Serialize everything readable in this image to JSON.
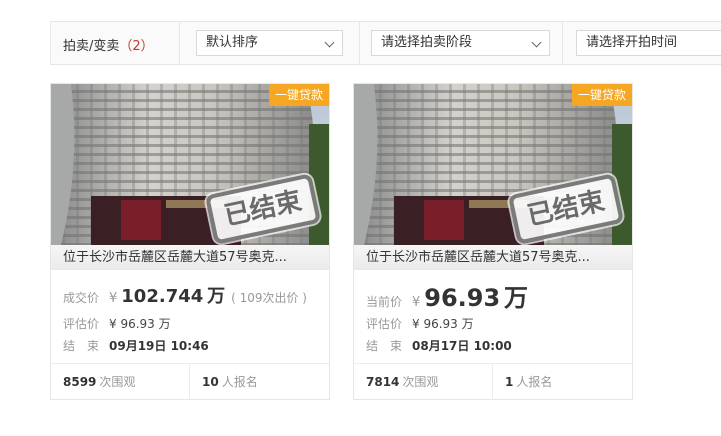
{
  "filters": {
    "category_label": "拍卖/变卖",
    "category_count": "（2）",
    "sort_value": "默认排序",
    "stage_value": "请选择拍卖阶段",
    "time_placeholder": "请选择开拍时间"
  },
  "accent_color": "#f5a623",
  "cards": [
    {
      "badge": "一键贷款",
      "stamp": "已结束",
      "title": "位于长沙市岳麓区岳麓大道57号奥克...",
      "price_label": "成交价",
      "currency": "¥",
      "price": "102.744",
      "price_unit": "万",
      "bids": "( 109次出价 )",
      "eval_label": "评估价",
      "eval_value": "¥ 96.93 万",
      "end_label": "结　束",
      "end_value": "09月19日 10:46",
      "views": "8599",
      "views_suffix": "次围观",
      "signups": "10",
      "signups_suffix": "人报名"
    },
    {
      "badge": "一键贷款",
      "stamp": "已结束",
      "title": "位于长沙市岳麓区岳麓大道57号奥克...",
      "price_label": "当前价",
      "currency": "¥",
      "price": "96.93",
      "price_unit": "万",
      "eval_label": "评估价",
      "eval_value": "¥ 96.93 万",
      "end_label": "结　束",
      "end_value": "08月17日 10:00",
      "views": "7814",
      "views_suffix": "次围观",
      "signups": "1",
      "signups_suffix": "人报名"
    }
  ]
}
